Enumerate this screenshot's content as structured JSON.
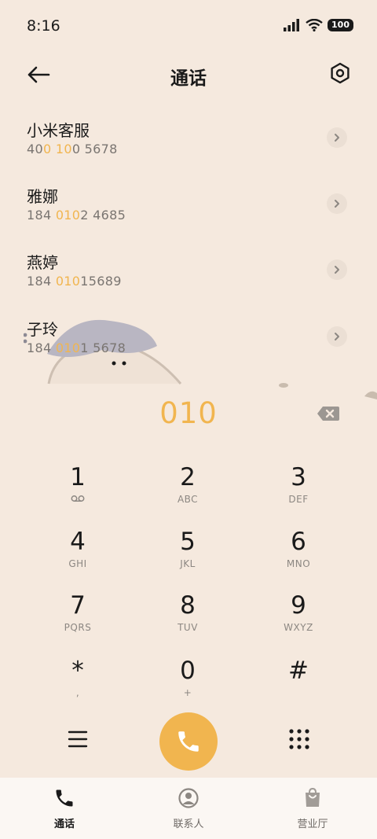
{
  "status": {
    "time": "8:16",
    "battery": "100"
  },
  "header": {
    "title": "通话"
  },
  "contacts": [
    {
      "name": "小米客服",
      "number": [
        {
          "t": "40"
        },
        {
          "t": "0",
          "hl": true
        },
        {
          "t": " "
        },
        {
          "t": "10",
          "hl": true
        },
        {
          "t": "0 5678"
        }
      ]
    },
    {
      "name": "雅娜",
      "number": [
        {
          "t": "184 "
        },
        {
          "t": "010",
          "hl": true
        },
        {
          "t": "2 4685"
        }
      ]
    },
    {
      "name": "燕婷",
      "number": [
        {
          "t": "184 "
        },
        {
          "t": "010",
          "hl": true
        },
        {
          "t": "15689"
        }
      ]
    },
    {
      "name": "子玲",
      "number": [
        {
          "t": "184 "
        },
        {
          "t": "010",
          "hl": true
        },
        {
          "t": "1 5678"
        }
      ]
    }
  ],
  "dialer": {
    "entered": "010",
    "keys": [
      {
        "digit": "1",
        "letters": ""
      },
      {
        "digit": "2",
        "letters": "ABC"
      },
      {
        "digit": "3",
        "letters": "DEF"
      },
      {
        "digit": "4",
        "letters": "GHI"
      },
      {
        "digit": "5",
        "letters": "JKL"
      },
      {
        "digit": "6",
        "letters": "MNO"
      },
      {
        "digit": "7",
        "letters": "PQRS"
      },
      {
        "digit": "8",
        "letters": "TUV"
      },
      {
        "digit": "9",
        "letters": "WXYZ"
      },
      {
        "digit": "*",
        "letters": ","
      },
      {
        "digit": "0",
        "letters": "+"
      },
      {
        "digit": "#",
        "letters": ""
      }
    ]
  },
  "nav": {
    "calls": "通话",
    "contacts": "联系人",
    "store": "营业厅"
  },
  "colors": {
    "accent": "#f1b54f",
    "background": "#f5e9de"
  },
  "icons": [
    "signal-icon",
    "wifi-icon",
    "battery-icon",
    "back-arrow-icon",
    "settings-icon",
    "chevron-right-icon",
    "voicemail-icon",
    "backspace-icon",
    "menu-icon",
    "phone-icon",
    "dialpad-icon",
    "contacts-icon",
    "store-icon"
  ]
}
